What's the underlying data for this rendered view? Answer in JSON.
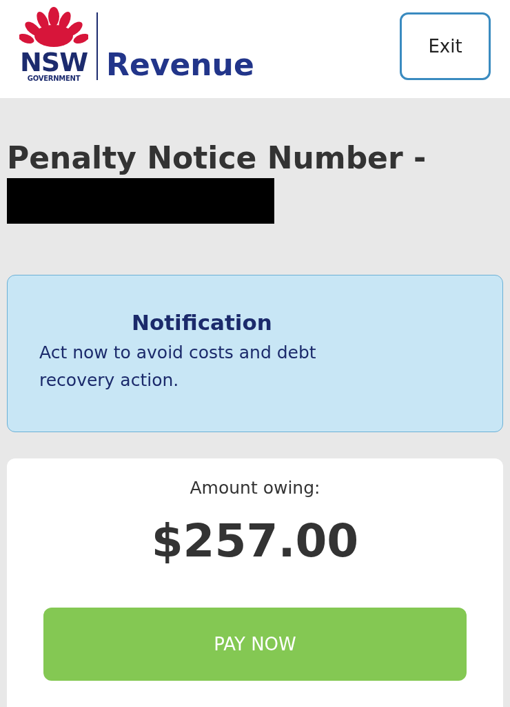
{
  "header": {
    "logo": {
      "mark": "NSW",
      "sub": "GOVERNMENT",
      "name": "Revenue"
    },
    "exit_button": "Exit"
  },
  "heading": "Penalty Notice Number -",
  "notification": {
    "title": "Notification",
    "message": "Act now to avoid costs and debt recovery action."
  },
  "amount": {
    "label": "Amount owing:",
    "value": "$257.00"
  },
  "pay_button": "PAY NOW"
}
